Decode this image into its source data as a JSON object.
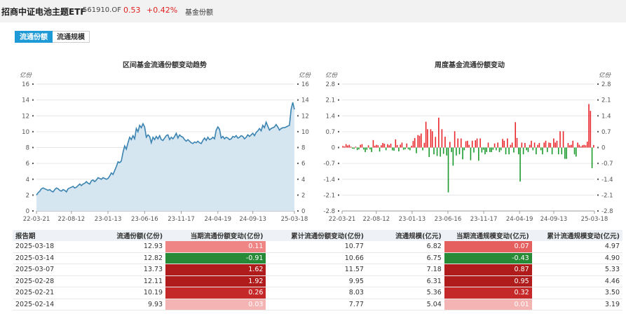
{
  "header": {
    "fund_name": "招商中证电池主题ETF",
    "fund_code": "561910.OF",
    "price": "0.53",
    "change": "+0.42%",
    "tag": "基金份额"
  },
  "tabs": [
    {
      "label": "流通份额",
      "active": true
    },
    {
      "label": "流通规模",
      "active": false
    }
  ],
  "chart_data": [
    {
      "type": "area",
      "title": "区间基金流通份额变动趋势",
      "ylabel": "亿份",
      "ylim": [
        0,
        16
      ],
      "yticks": [
        0,
        2,
        4,
        6,
        8,
        10,
        12,
        14,
        16
      ],
      "xtick_labels": [
        "22-03-21",
        "22-08-12",
        "23-01-13",
        "23-06-16",
        "23-11-17",
        "24-04-19",
        "24-09-13",
        "25-03-18"
      ],
      "x_span": [
        0,
        155
      ],
      "xtick_positions": [
        0,
        21,
        43,
        65,
        87,
        109,
        130,
        155
      ],
      "grid": true,
      "color": "#3b83b0",
      "fill": "#d5e6f1",
      "series": [
        {
          "values": [
            2.0,
            2.3,
            2.5,
            2.8,
            2.9,
            2.8,
            2.7,
            2.6,
            2.7,
            2.5,
            2.4,
            2.7,
            2.9,
            2.8,
            2.6,
            2.5,
            2.7,
            2.6,
            2.4,
            2.8,
            2.9,
            3.0,
            3.1,
            2.9,
            3.0,
            3.2,
            3.4,
            3.2,
            3.4,
            3.5,
            3.7,
            3.5,
            3.4,
            3.8,
            3.9,
            3.7,
            3.9,
            4.2,
            4.1,
            4.0,
            4.2,
            4.1,
            4.0,
            4.1,
            4.4,
            4.8,
            4.6,
            5.1,
            5.6,
            6.2,
            6.1,
            6.3,
            7.4,
            8.2,
            7.8,
            8.6,
            9.3,
            9.0,
            9.5,
            9.1,
            10.4,
            10.0,
            10.8,
            10.5,
            11.0,
            10.6,
            9.3,
            9.6,
            9.4,
            8.6,
            9.3,
            9.0,
            9.4,
            9.1,
            9.5,
            9.0,
            8.9,
            9.2,
            9.5,
            9.6,
            9.0,
            9.3,
            9.1,
            9.4,
            9.8,
            9.2,
            9.6,
            9.4,
            9.3,
            9.0,
            8.8,
            9.0,
            8.8,
            8.6,
            8.5,
            8.7,
            8.6,
            8.8,
            8.6,
            8.5,
            8.9,
            9.2,
            8.9,
            9.3,
            9.0,
            9.1,
            9.3,
            9.1,
            10.2,
            10.6,
            10.3,
            9.2,
            9.4,
            9.1,
            9.3,
            9.2,
            9.0,
            9.1,
            9.4,
            9.3,
            9.5,
            9.2,
            9.3,
            9.5,
            9.4,
            9.1,
            9.3,
            9.6,
            9.4,
            9.6,
            9.8,
            9.5,
            9.9,
            10.1,
            10.4,
            10.1,
            10.8,
            10.5,
            11.2,
            10.7,
            10.2,
            10.4,
            10.5,
            10.6,
            10.9,
            10.6,
            10.2,
            10.4,
            10.5,
            10.5,
            10.6,
            10.7,
            10.8,
            12.8,
            13.7,
            12.8
          ]
        }
      ]
    },
    {
      "type": "bar",
      "title": "周度基金流通份额变动",
      "ylabel": "亿份",
      "ylim": [
        -2.8,
        2.8
      ],
      "yticks": [
        -2.8,
        -2.1,
        -1.4,
        -0.7,
        0,
        0.7,
        1.4,
        2.1,
        2.8
      ],
      "xtick_labels": [
        "22-03-21",
        "22-08-12",
        "23-01-13",
        "23-06-16",
        "23-11-17",
        "24-04-19",
        "24-09-13",
        "25-03-18"
      ],
      "x_span": [
        0,
        155
      ],
      "xtick_positions": [
        0,
        21,
        43,
        65,
        87,
        109,
        130,
        155
      ],
      "grid": true,
      "positive_color": "#e8262b",
      "negative_color": "#1a9a2c",
      "series": [
        {
          "values": [
            0.07,
            0.05,
            0.15,
            0.09,
            0.12,
            0.04,
            -0.05,
            -0.06,
            0.04,
            -0.11,
            -0.08,
            0.12,
            0.15,
            -0.09,
            -0.2,
            -0.1,
            0.1,
            -0.08,
            -0.2,
            0.33,
            0.08,
            0.12,
            0.1,
            -0.18,
            0.1,
            0.2,
            0.17,
            -0.12,
            0.15,
            0.1,
            0.17,
            -0.12,
            -0.14,
            0.36,
            0.11,
            -0.17,
            0.13,
            0.22,
            -0.1,
            -0.08,
            0.18,
            -0.08,
            -0.12,
            0.08,
            0.29,
            0.42,
            -0.25,
            0.55,
            0.52,
            0.62,
            -0.12,
            0.21,
            1.14,
            0.81,
            -0.42,
            0.81,
            0.72,
            -0.3,
            0.47,
            -0.37,
            1.32,
            -0.4,
            0.81,
            -0.28,
            0.48,
            -0.35,
            -1.98,
            0.25,
            -0.2,
            -0.8,
            0.72,
            -0.35,
            0.4,
            -0.3,
            0.4,
            -0.52,
            -0.12,
            0.28,
            0.3,
            0.12,
            -0.56,
            0.3,
            -0.22,
            0.32,
            0.4,
            -0.58,
            0.4,
            -0.22,
            -0.1,
            -0.3,
            -0.2,
            0.22,
            -0.2,
            -0.2,
            -0.1,
            0.18,
            -0.12,
            0.22,
            -0.2,
            -0.12,
            0.38,
            0.3,
            -0.3,
            0.4,
            -0.3,
            0.12,
            0.22,
            -0.22,
            1.12,
            0.42,
            -0.3,
            -1.5,
            0.22,
            -0.3,
            0.2,
            -0.12,
            -0.2,
            0.12,
            0.3,
            -0.12,
            0.22,
            -0.3,
            0.12,
            0.2,
            -0.12,
            -0.3,
            0.22,
            0.3,
            -0.2,
            0.22,
            0.2,
            -0.3,
            0.4,
            0.22,
            0.3,
            -0.3,
            0.72,
            -0.3,
            0.72,
            -0.5,
            -0.5,
            0.2,
            0.1,
            0.12,
            0.3,
            -0.3,
            -0.4,
            0.22,
            0.12,
            0.05,
            0.1,
            0.12,
            0.1,
            0.26,
            1.92,
            1.62,
            -0.91,
            0.11
          ]
        }
      ]
    }
  ],
  "table": {
    "headers": [
      "报告期",
      "流通份额(亿份)",
      "当期流通份额变动(亿份)",
      "累计流通份额变动(亿份)",
      "流通规模(亿元)",
      "当期流通规模变动(亿元)",
      "累计流通规模变动(亿元)"
    ],
    "rows": [
      {
        "date": "2025-03-18",
        "shares": "12.93",
        "share_chg": "0.11",
        "share_cum": "10.77",
        "scale": "6.82",
        "scale_chg": "0.07",
        "scale_cum": "4.97",
        "share_chg_color": "#f08585",
        "scale_chg_color": "#e65f5f"
      },
      {
        "date": "2025-03-14",
        "shares": "12.82",
        "share_chg": "-0.91",
        "share_cum": "10.66",
        "scale": "6.75",
        "scale_chg": "-0.43",
        "scale_cum": "4.90",
        "share_chg_color": "#268a37",
        "scale_chg_color": "#268a37"
      },
      {
        "date": "2025-03-07",
        "shares": "13.73",
        "share_chg": "1.62",
        "share_cum": "11.57",
        "scale": "7.18",
        "scale_chg": "0.87",
        "scale_cum": "5.33",
        "share_chg_color": "#b01c1c",
        "scale_chg_color": "#b01c1c"
      },
      {
        "date": "2025-02-28",
        "shares": "12.11",
        "share_chg": "1.92",
        "share_cum": "9.95",
        "scale": "6.31",
        "scale_chg": "0.95",
        "scale_cum": "4.46",
        "share_chg_color": "#b01c1c",
        "scale_chg_color": "#b01c1c"
      },
      {
        "date": "2025-02-21",
        "shares": "10.19",
        "share_chg": "0.26",
        "share_cum": "8.03",
        "scale": "5.36",
        "scale_chg": "0.32",
        "scale_cum": "3.50",
        "share_chg_color": "#c42828",
        "scale_chg_color": "#c42828"
      },
      {
        "date": "2025-02-14",
        "shares": "9.93",
        "share_chg": "0.03",
        "share_cum": "7.77",
        "scale": "5.04",
        "scale_chg": "0.01",
        "scale_cum": "3.19",
        "share_chg_color": "#f5b4b4",
        "scale_chg_color": "#f5b4b4"
      }
    ]
  }
}
